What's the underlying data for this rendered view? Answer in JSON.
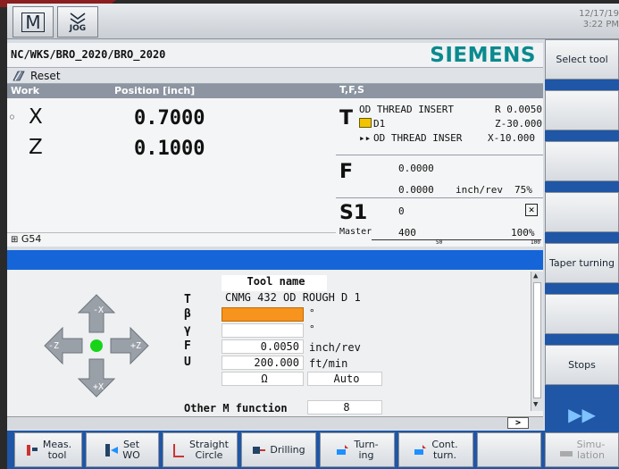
{
  "topbar": {
    "mode_m": "M",
    "mode_jog": "JOG",
    "date": "12/17/19",
    "time": "3:22 PM"
  },
  "header": {
    "path": "NC/WKS/BRO_2020/BRO_2020",
    "brand": "SIEMENS",
    "reset": "Reset"
  },
  "work": {
    "col_work": "Work",
    "col_position": "Position [inch]",
    "axes": [
      {
        "name": "X",
        "value": "0.7000"
      },
      {
        "name": "Z",
        "value": "0.1000"
      }
    ],
    "wcs": "G54"
  },
  "tfs": {
    "title": "T,F,S",
    "t": {
      "letter": "T",
      "tool": "OD THREAD INSERT",
      "r": "R 0.0050",
      "d": "D1",
      "dz": "Z-30.000",
      "next": "OD THREAD INSER",
      "nx": "X-10.000"
    },
    "f": {
      "letter": "F",
      "v1": "0.0000",
      "v2": "0.0000",
      "unit": "inch/rev",
      "pct": "75%"
    },
    "s": {
      "letter": "S1",
      "v1": "0",
      "label": "Master",
      "v2": "400",
      "pct": "100%",
      "scale_mid": "50",
      "scale_end": "100"
    }
  },
  "lower": {
    "tool_name_hdr": "Tool name",
    "rows": [
      {
        "label": "T",
        "value": "CNMG 432 OD ROUGH  D 1"
      },
      {
        "label": "β",
        "value": "",
        "suffix": "°"
      },
      {
        "label": "γ",
        "value": "",
        "suffix": "°"
      },
      {
        "label": "F",
        "value": "0.0050",
        "suffix": "inch/rev"
      },
      {
        "label": "U",
        "value": "200.000",
        "suffix": "ft/min"
      },
      {
        "label": "",
        "value": "Ω",
        "suffix": "Auto"
      }
    ],
    "other_m": "Other M function",
    "other_m_val": "8",
    "joy": {
      "up": "-X",
      "down": "+X",
      "left": "-Z",
      "right": "+Z"
    },
    "scroll_arrow": ">"
  },
  "softkeys_right": [
    "Select tool",
    "",
    "",
    "",
    "",
    "Taper turning",
    "",
    "Stops",
    "▶▶"
  ],
  "softkeys_bottom": [
    {
      "l1": "Meas.",
      "l2": "tool"
    },
    {
      "l1": "Set",
      "l2": "WO"
    },
    {
      "l1": "Straight",
      "l2": "Circle"
    },
    {
      "l1": "Drilling",
      "l2": ""
    },
    {
      "l1": "Turn-",
      "l2": "ing"
    },
    {
      "l1": "Cont.",
      "l2": "turn."
    },
    {
      "l1": "",
      "l2": ""
    },
    {
      "l1": "Simu-",
      "l2": "lation"
    }
  ],
  "colors": {
    "brand": "#0a8a8e",
    "blue": "#1565d8",
    "softkey_sep": "#1f56a6",
    "orange": "#f7941d",
    "green": "#18d418"
  }
}
